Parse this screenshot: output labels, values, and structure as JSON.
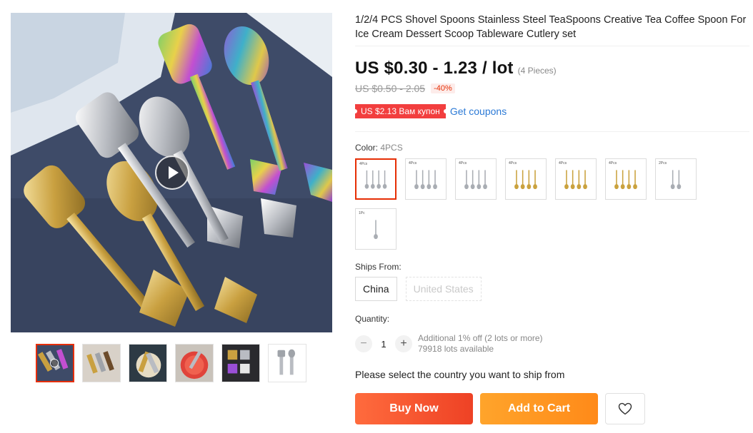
{
  "product": {
    "title": "1/2/4 PCS Shovel Spoons Stainless Steel TeaSpoons Creative Tea Coffee Spoon For Ice Cream Dessert Scoop Tableware Cutlery set"
  },
  "price": {
    "current": "US $0.30 - 1.23 / lot",
    "unit_count": "(4 Pieces)",
    "original": "US $0.50 - 2.05",
    "discount": "-40%"
  },
  "coupon": {
    "tag": "US $2.13 Вам купон",
    "link": "Get coupons"
  },
  "color": {
    "label": "Color:",
    "selected": "4PCS",
    "options": [
      {
        "tag": "4Pcs",
        "metal": "silver",
        "count": 4
      },
      {
        "tag": "4Pcs",
        "metal": "silver",
        "count": 4
      },
      {
        "tag": "4Pcs",
        "metal": "silver",
        "count": 4
      },
      {
        "tag": "4Pcs",
        "metal": "gold",
        "count": 4
      },
      {
        "tag": "4Pcs",
        "metal": "gold",
        "count": 4
      },
      {
        "tag": "4Pcs",
        "metal": "gold",
        "count": 4
      },
      {
        "tag": "2Pcs",
        "metal": "silver",
        "count": 2
      },
      {
        "tag": "1Pc",
        "metal": "silver",
        "count": 1
      }
    ]
  },
  "shipping": {
    "label": "Ships From:",
    "options": [
      "China",
      "United States"
    ]
  },
  "quantity": {
    "label": "Quantity:",
    "value": "1",
    "minus": "−",
    "plus": "+",
    "discount_note": "Additional 1% off (2 lots or more)",
    "available": "79918 lots available"
  },
  "ship_note": "Please select the country you want to ship from",
  "buttons": {
    "buy": "Buy Now",
    "cart": "Add to Cart",
    "wishlist_icon": "heart-icon"
  },
  "colors": {
    "accent": "#e62e04",
    "coupon_bg": "#f23e3e",
    "link": "#2c7ad6",
    "buy_btn": "#ee4225",
    "cart_btn": "#ff8a19"
  }
}
